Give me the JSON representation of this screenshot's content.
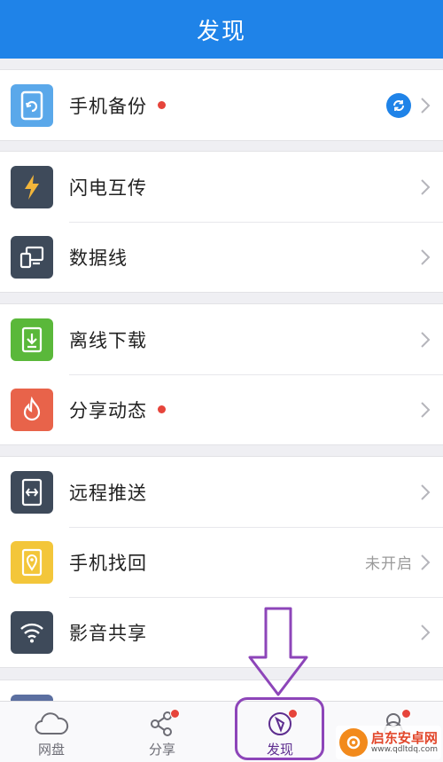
{
  "header": {
    "title": "发现"
  },
  "groups": [
    {
      "items": [
        {
          "label": "手机备份",
          "icon": "phone-backup-icon",
          "color": "#5aa8ea",
          "dot": true,
          "badge": "sync-icon"
        }
      ]
    },
    {
      "items": [
        {
          "label": "闪电互传",
          "icon": "lightning-icon",
          "color": "#3e4a5a"
        },
        {
          "label": "数据线",
          "icon": "data-cable-icon",
          "color": "#3e4a5a"
        }
      ]
    },
    {
      "items": [
        {
          "label": "离线下载",
          "icon": "download-icon",
          "color": "#5ab83a"
        },
        {
          "label": "分享动态",
          "icon": "flame-icon",
          "color": "#e8634a",
          "dot": true
        }
      ]
    },
    {
      "items": [
        {
          "label": "远程推送",
          "icon": "remote-push-icon",
          "color": "#3e4a5a"
        },
        {
          "label": "手机找回",
          "icon": "location-pin-icon",
          "color": "#f3c63a",
          "status": "未开启"
        },
        {
          "label": "影音共享",
          "icon": "wifi-icon",
          "color": "#3e4a5a"
        }
      ]
    }
  ],
  "tabbar": {
    "tabs": [
      {
        "label": "网盘",
        "icon": "cloud-icon",
        "dot": false,
        "active": false
      },
      {
        "label": "分享",
        "icon": "share-icon",
        "dot": true,
        "active": false
      },
      {
        "label": "发现",
        "icon": "compass-icon",
        "dot": true,
        "active": true
      },
      {
        "label": "",
        "icon": "profile-icon",
        "dot": true,
        "active": false
      }
    ]
  },
  "watermark": {
    "title": "启东安卓网",
    "url": "www.qdltdq.com"
  },
  "colors": {
    "header": "#1f83e8",
    "highlight": "#8d45b9",
    "dot": "#e6443b"
  }
}
